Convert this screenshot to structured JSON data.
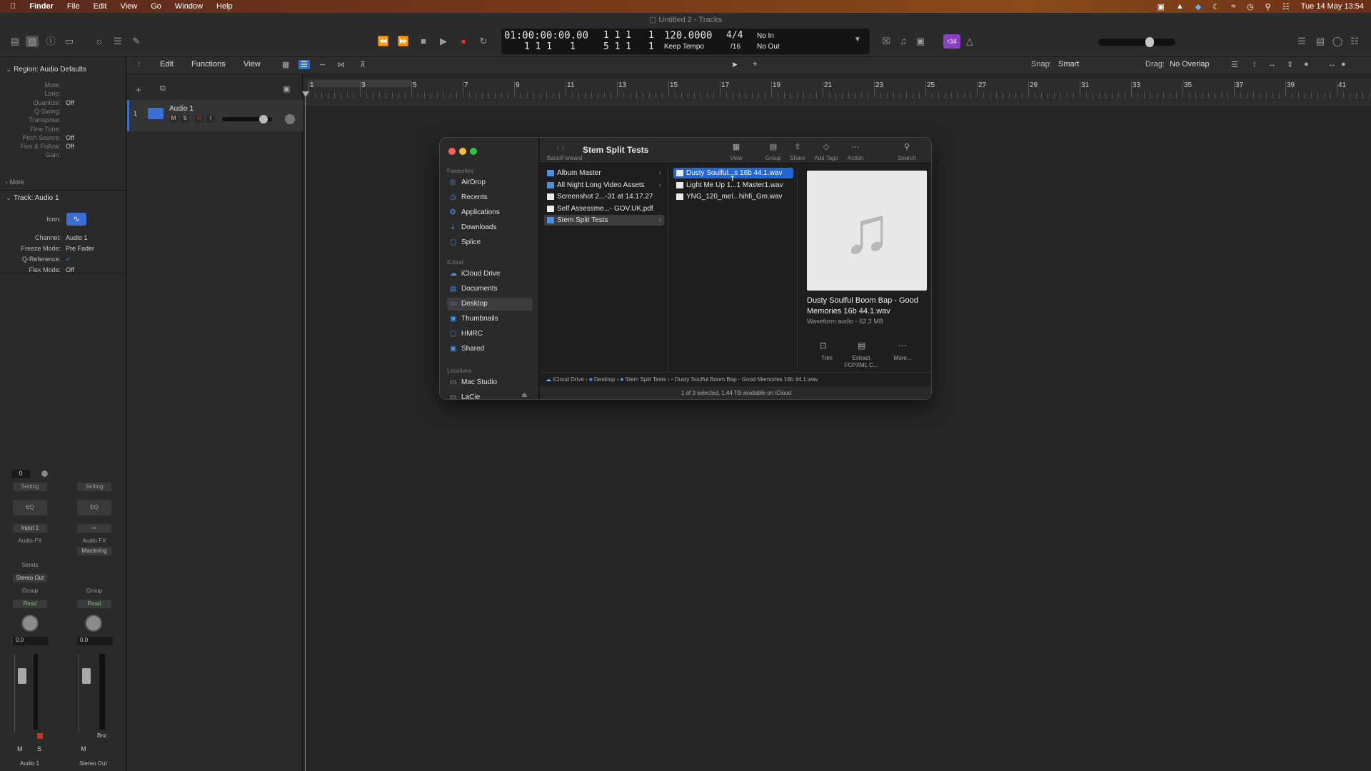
{
  "menubar": {
    "apple": "",
    "items": [
      "Finder",
      "File",
      "Edit",
      "View",
      "Go",
      "Window",
      "Help"
    ],
    "datetime": "Tue 14 May  13:54"
  },
  "window_title": "Untitled 2 - Tracks",
  "lcd": {
    "timecode": "01:00:00:00.00",
    "bars1": "1  1  1",
    "beat1": "1",
    "tempo": "120.0000",
    "time_sig": "4/4",
    "no_in": "No In",
    "pos2": "1  1  1",
    "beat2": "1",
    "bars3": "5  1  1",
    "beat3": "1",
    "keep_tempo": "Keep Tempo",
    "div": "/16",
    "no_out": "No Out"
  },
  "badge": "♮34",
  "secondbar": {
    "edit": "Edit",
    "functions": "Functions",
    "view": "View",
    "snap_label": "Snap:",
    "snap_value": "Smart",
    "drag_label": "Drag:",
    "drag_value": "No Overlap"
  },
  "inspector": {
    "region_title": "Region: Audio Defaults",
    "rows": [
      {
        "k": "Mute:",
        "v": ""
      },
      {
        "k": "Loop:",
        "v": ""
      },
      {
        "k": "Quantize:",
        "v": "Off"
      },
      {
        "k": "Q-Swing:",
        "v": ""
      },
      {
        "k": "Transpose:",
        "v": ""
      },
      {
        "k": "Fine Tune:",
        "v": ""
      },
      {
        "k": "Pitch Source:",
        "v": "Off"
      },
      {
        "k": "Flex & Follow:",
        "v": "Off"
      },
      {
        "k": "Gain:",
        "v": ""
      }
    ],
    "more": "More",
    "track_title": "Track:  Audio 1",
    "track_rows": [
      {
        "k": "Icon:",
        "v": ""
      },
      {
        "k": "Channel:",
        "v": "Audio 1"
      },
      {
        "k": "Freeze Mode:",
        "v": "Pre Fader"
      },
      {
        "k": "Q-Reference:",
        "v": "✓"
      },
      {
        "k": "Flex Mode:",
        "v": "Off"
      }
    ]
  },
  "mixer": {
    "strip1": {
      "value": "0",
      "setting": "Setting",
      "eq": "EQ",
      "input": "Input 1",
      "audiofx": "Audio FX",
      "sends": "Sends",
      "output": "Stereo Out",
      "group": "Group",
      "read": "Read",
      "vol": "0.0",
      "m": "M",
      "s": "S",
      "name": "Audio 1"
    },
    "strip2": {
      "setting": "Setting",
      "eq": "EQ",
      "link": "∞",
      "audiofx": "Audio FX",
      "mastering": "Mastering",
      "group": "Group",
      "read": "Read",
      "vol": "0.0",
      "bnc": "Bnc",
      "m": "M",
      "name": "Stereo Out"
    }
  },
  "track": {
    "number": "1",
    "name": "Audio 1",
    "m": "M",
    "s": "S",
    "r": "R",
    "i": "I"
  },
  "ruler": [
    "1",
    "3",
    "5",
    "7",
    "9",
    "11",
    "13",
    "15",
    "17",
    "19",
    "21",
    "23",
    "25",
    "27",
    "29",
    "31",
    "33",
    "35",
    "37",
    "39",
    "41"
  ],
  "finder": {
    "title": "Stem Split Tests",
    "back_forward": "Back/Forward",
    "toolbar": [
      "View",
      "Group",
      "Share",
      "Add Tags",
      "Action",
      "Search"
    ],
    "favourites_label": "Favourites",
    "favourites": [
      "AirDrop",
      "Recents",
      "Applications",
      "Downloads",
      "Splice"
    ],
    "icloud_label": "iCloud",
    "icloud": [
      "iCloud Drive",
      "Documents",
      "Desktop",
      "Thumbnails",
      "HMRC",
      "Shared"
    ],
    "locations_label": "Locations",
    "locations": [
      "Mac Studio",
      "LaCie"
    ],
    "col1": [
      "Album Master",
      "All Night Long Video Assets",
      "Screenshot 2...-31 at 14.17.27",
      "Self Assessme...- GOV.UK.pdf",
      "Stem Split Tests"
    ],
    "col2": [
      "Dusty Soulful...s 16b 44.1.wav",
      "Light Me Up 1...1 Master1.wav",
      "YNG_120_mel...hihfi_Gm.wav"
    ],
    "preview_name": "Dusty Soulful Boom Bap - Good Memories 16b 44.1.wav",
    "preview_info": "Waveform audio - 62.3 MB",
    "actions": [
      "Trim",
      "Extract FCPXML C...",
      "More..."
    ],
    "path": [
      "iCloud Drive",
      "Desktop",
      "Stem Split Tests",
      "Dusty Soulful Boom Bap - Good Memories 16b 44.1.wav"
    ],
    "status": "1 of 3 selected, 1.44 TB available on iCloud"
  }
}
